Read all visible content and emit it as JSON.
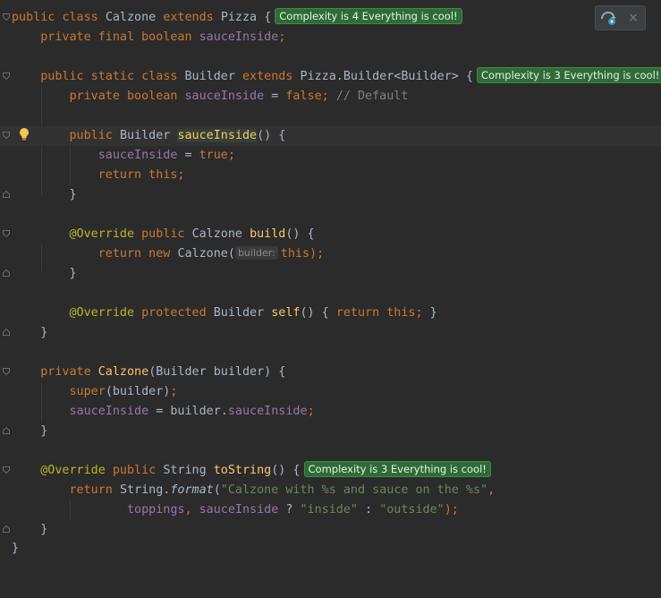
{
  "editor": {
    "lines": {
      "l1": {
        "kw_public": "public",
        "kw_class": "class",
        "name": "Calzone",
        "kw_extends": "extends",
        "parent": "Pizza",
        "brace": "{",
        "badge": "Complexity is 4 Everything is cool!"
      },
      "l2": {
        "kw": "private final boolean",
        "field": "sauceInside",
        "end": ";"
      },
      "l4": {
        "kw": "public static class",
        "name": "Builder",
        "kw_extends": "extends",
        "parent": "Pizza.Builder<Builder>",
        "brace": "{",
        "badge": "Complexity is 3 Everything is cool!"
      },
      "l5": {
        "kw": "private boolean",
        "field": "sauceInside",
        "eq": "=",
        "val": "false;",
        "comment": "// Default"
      },
      "l7": {
        "kw": "public",
        "type": "Builder",
        "method": "sauceInside",
        "rest": "() {"
      },
      "l8": {
        "field": "sauceInside",
        "eq": "=",
        "val": "true;"
      },
      "l9": {
        "kw": "return this;"
      },
      "l10": {
        "text": "}"
      },
      "l12": {
        "ann": "@Override",
        "kw": "public",
        "type": "Calzone",
        "method": "build",
        "rest": "() {"
      },
      "l13": {
        "kw": "return new",
        "ctor": "Calzone(",
        "hint": "builder:",
        "this": "this",
        "end": ");"
      },
      "l14": {
        "text": "}"
      },
      "l16": {
        "ann": "@Override",
        "kw": "protected",
        "type": "Builder",
        "method": "self",
        "mid": "() {",
        "ret": "return this;",
        "end": "}"
      },
      "l17": {
        "text": "}"
      },
      "l19": {
        "kw": "private",
        "ctor": "Calzone",
        "rest": "(Builder builder) {"
      },
      "l20": {
        "kw": "super",
        "rest": "(builder)",
        "semi": ";"
      },
      "l21": {
        "field": "sauceInside",
        "eq": "= builder.",
        "field2": "sauceInside",
        "semi": ";"
      },
      "l22": {
        "text": "}"
      },
      "l24": {
        "ann": "@Override",
        "kw": "public",
        "type": "String",
        "method": "toString",
        "rest": "() {",
        "badge": "Complexity is 3 Everything is cool!"
      },
      "l25": {
        "kw": "return",
        "cls": "String.",
        "method": "format",
        "open": "(",
        "str": "\"Calzone with %s and sauce on the %s\"",
        "comma": ","
      },
      "l26": {
        "field": "toppings",
        "comma": ",",
        "field2": "sauceInside",
        "q": "?",
        "s1": "\"inside\"",
        "colon": ":",
        "s2": "\"outside\"",
        "end": ");"
      },
      "l27": {
        "text": "}"
      },
      "l28": {
        "text": "}"
      }
    }
  },
  "toolbar": {
    "icon1": "reload-gradle-icon",
    "icon2": "close-icon",
    "close_glyph": "×"
  },
  "icons": {
    "bulb": "lightbulb-icon"
  },
  "colors": {
    "background": "#2b2b2b",
    "keyword": "#cc7832",
    "field": "#9876aa",
    "method": "#ffc66d",
    "annotation": "#bbb529",
    "string": "#6a8759",
    "badge": "#2e6b36"
  }
}
